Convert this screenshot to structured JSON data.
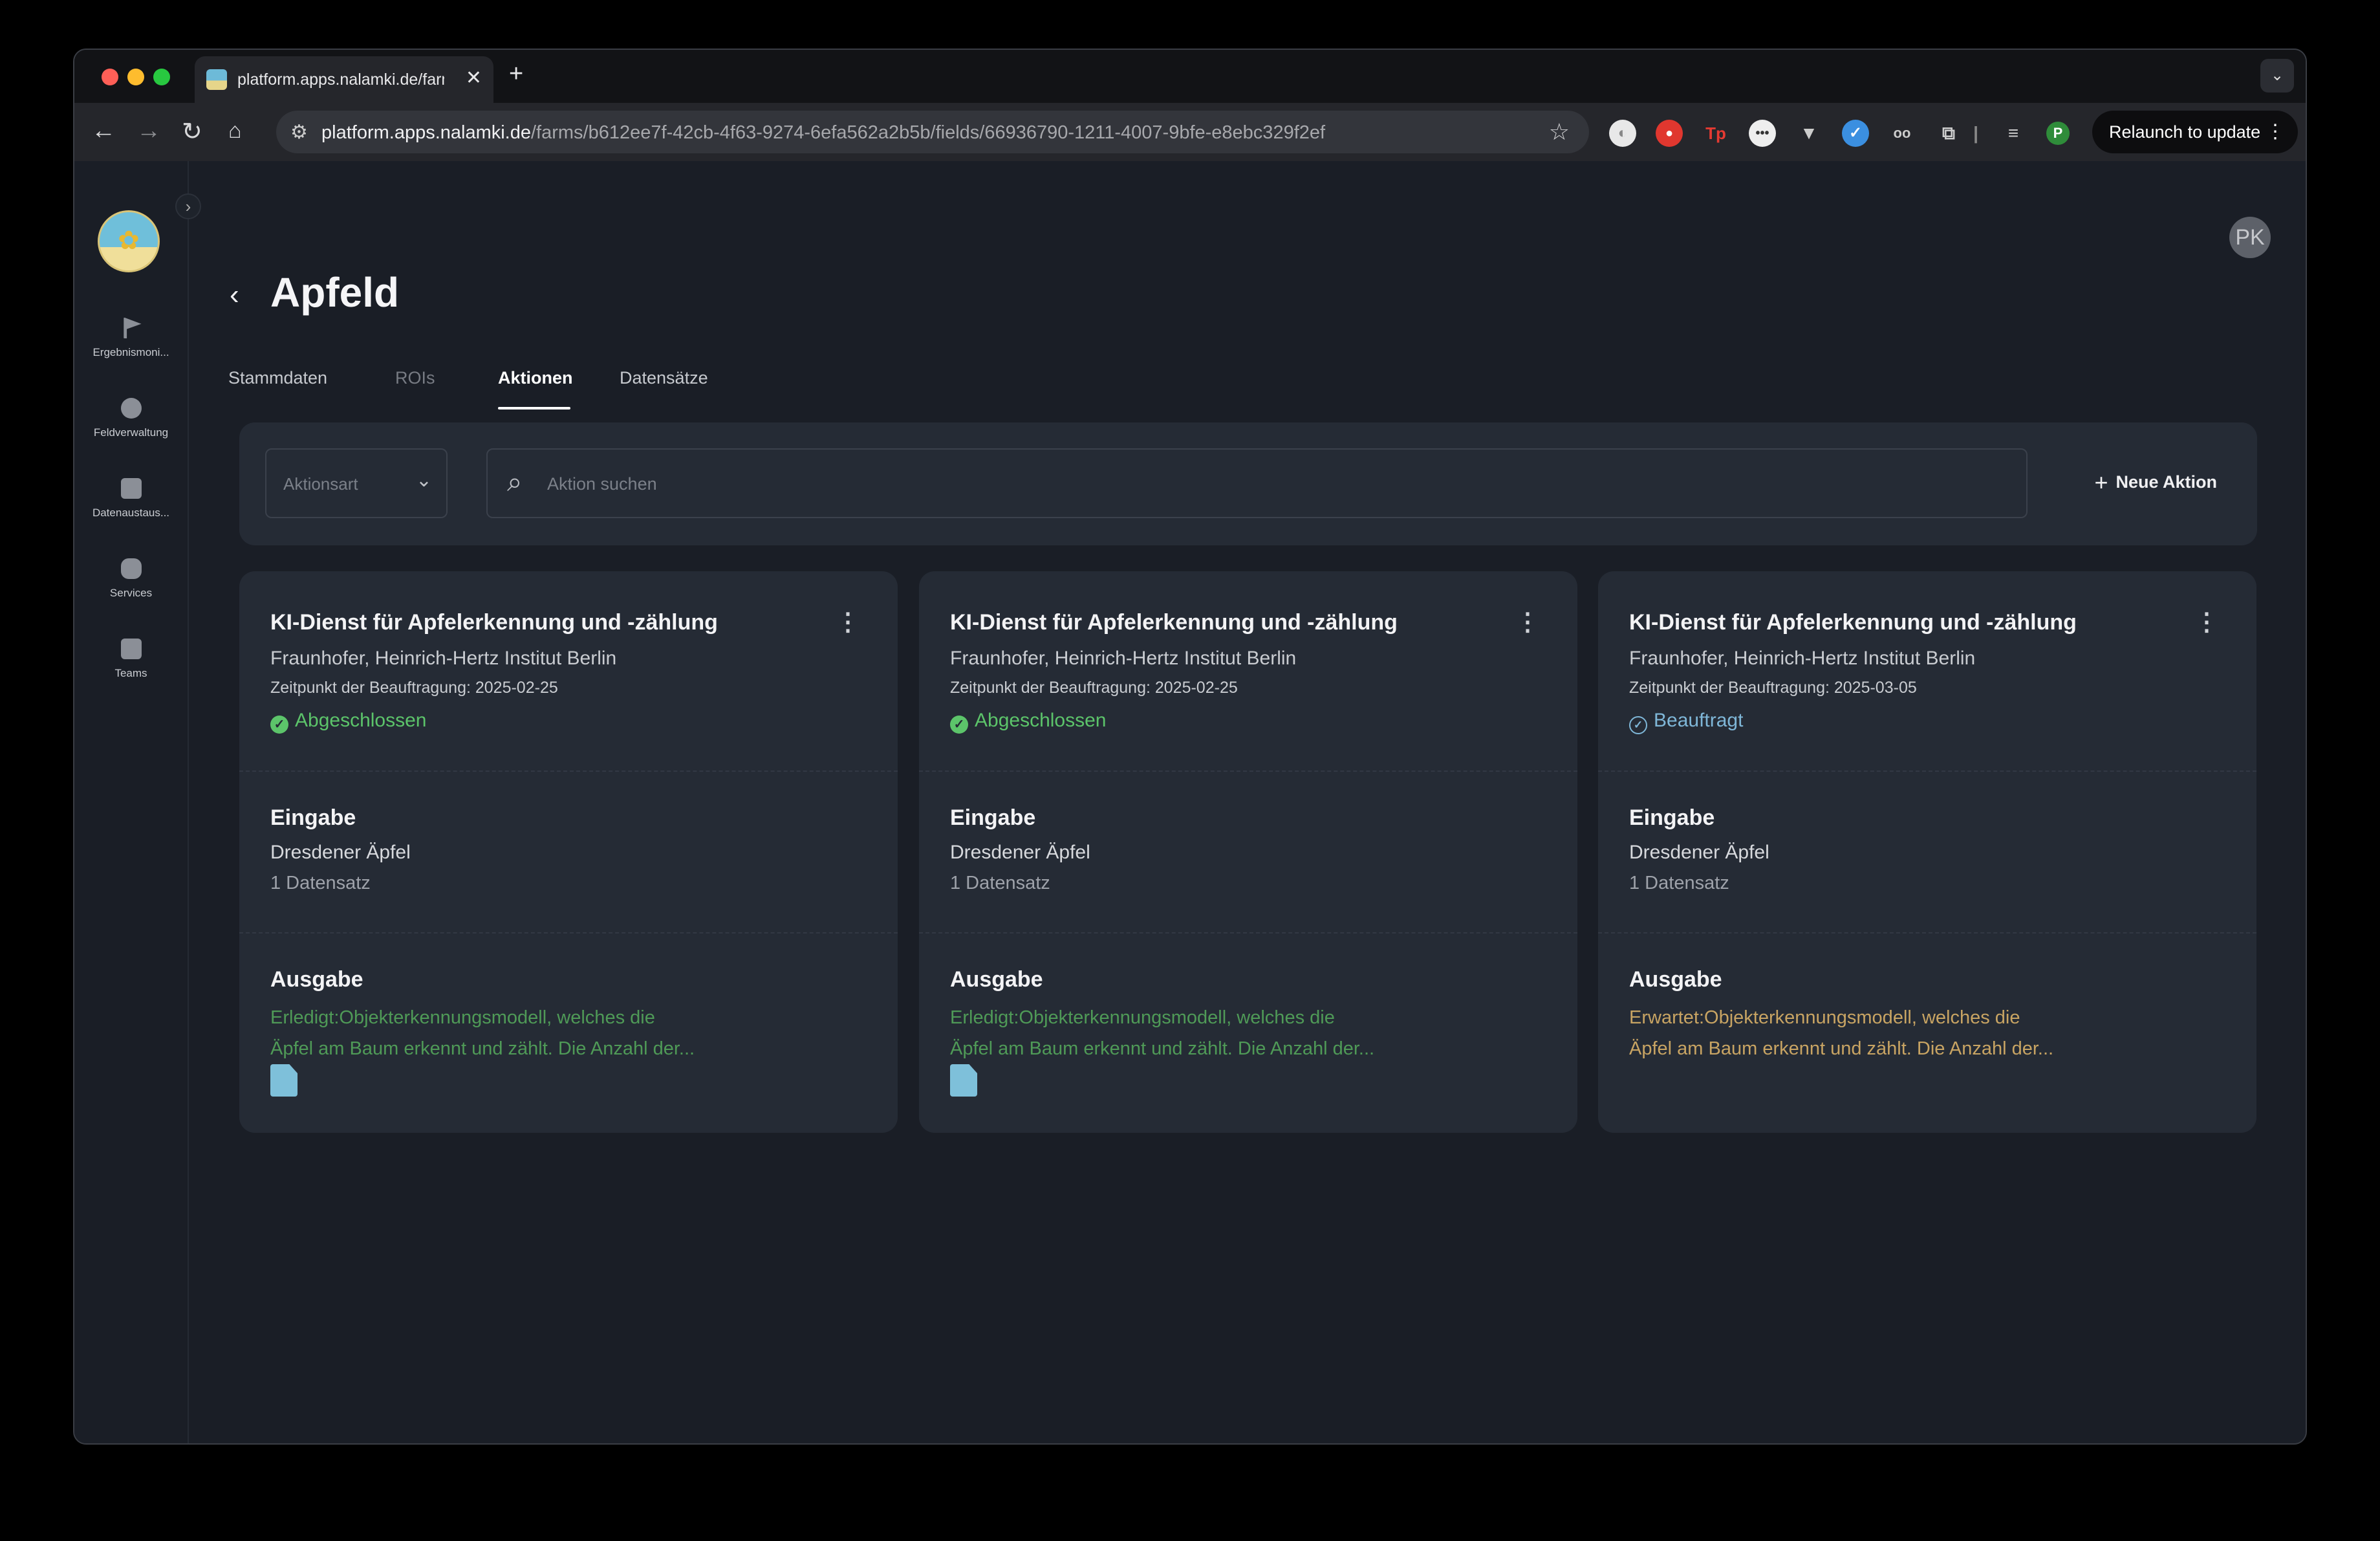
{
  "browser": {
    "tab_title": "platform.apps.nalamki.de/farms",
    "new_tab": "+",
    "url_host": "platform.apps.nalamki.de",
    "url_path": "/farms/b612ee7f-42cb-4f63-9274-6efa562a2b5b/fields/66936790-1211-4007-9bfe-e8ebc329f2ef",
    "relaunch_label": "Relaunch to update",
    "profile_initial": "P",
    "colors": {
      "close_dot": "#fe5f57",
      "min_dot": "#febc2e",
      "max_dot": "#28c840"
    }
  },
  "sidebar": {
    "items": [
      {
        "label": "Ergebnismoni...",
        "icon": "flag-icon"
      },
      {
        "label": "Feldverwaltung",
        "icon": "gauge-icon"
      },
      {
        "label": "Datenaustaus...",
        "icon": "document-icon"
      },
      {
        "label": "Services",
        "icon": "services-icon"
      },
      {
        "label": "Teams",
        "icon": "person-icon"
      }
    ]
  },
  "user": {
    "initials": "PK"
  },
  "page": {
    "title": "Apfeld",
    "tabs": [
      {
        "label": "Stammdaten",
        "active": false
      },
      {
        "label": "ROIs",
        "active": false
      },
      {
        "label": "Aktionen",
        "active": true
      },
      {
        "label": "Datensätze",
        "active": false
      }
    ]
  },
  "filters": {
    "type_placeholder": "Aktionsart",
    "search_placeholder": "Aktion suchen",
    "new_action_label": "Neue Aktion"
  },
  "cards": [
    {
      "title": "KI-Dienst für Apfelerkennung und -zählung",
      "org": "Fraunhofer, Heinrich-Hertz Institut Berlin",
      "date": "Zeitpunkt der Beauftragung: 2025-02-25",
      "status": "Abgeschlossen",
      "status_color": "#5cc46a",
      "input_heading": "Eingabe",
      "input_value": "Dresdener Äpfel",
      "input_count": "1 Datensatz",
      "output_heading": "Ausgabe",
      "output_line1": "Erledigt:Objekterkennungsmodell, welches die",
      "output_line2": "Äpfel am Baum erkennt und zählt. Die Anzahl der...",
      "output_color": "#4f9a57",
      "has_file": true
    },
    {
      "title": "KI-Dienst für Apfelerkennung und -zählung",
      "org": "Fraunhofer, Heinrich-Hertz Institut Berlin",
      "date": "Zeitpunkt der Beauftragung: 2025-02-25",
      "status": "Abgeschlossen",
      "status_color": "#5cc46a",
      "input_heading": "Eingabe",
      "input_value": "Dresdener Äpfel",
      "input_count": "1 Datensatz",
      "output_heading": "Ausgabe",
      "output_line1": "Erledigt:Objekterkennungsmodell, welches die",
      "output_line2": "Äpfel am Baum erkennt und zählt. Die Anzahl der...",
      "output_color": "#4f9a57",
      "has_file": true
    },
    {
      "title": "KI-Dienst für Apfelerkennung und -zählung",
      "org": "Fraunhofer, Heinrich-Hertz Institut Berlin",
      "date": "Zeitpunkt der Beauftragung: 2025-03-05",
      "status": "Beauftragt",
      "status_color": "#7fb7d8",
      "input_heading": "Eingabe",
      "input_value": "Dresdener Äpfel",
      "input_count": "1 Datensatz",
      "output_heading": "Ausgabe",
      "output_line1": "Erwartet:Objekterkennungsmodell, welches die",
      "output_line2": "Äpfel am Baum erkennt und zählt. Die Anzahl der...",
      "output_color": "#c8a463",
      "has_file": false
    }
  ]
}
